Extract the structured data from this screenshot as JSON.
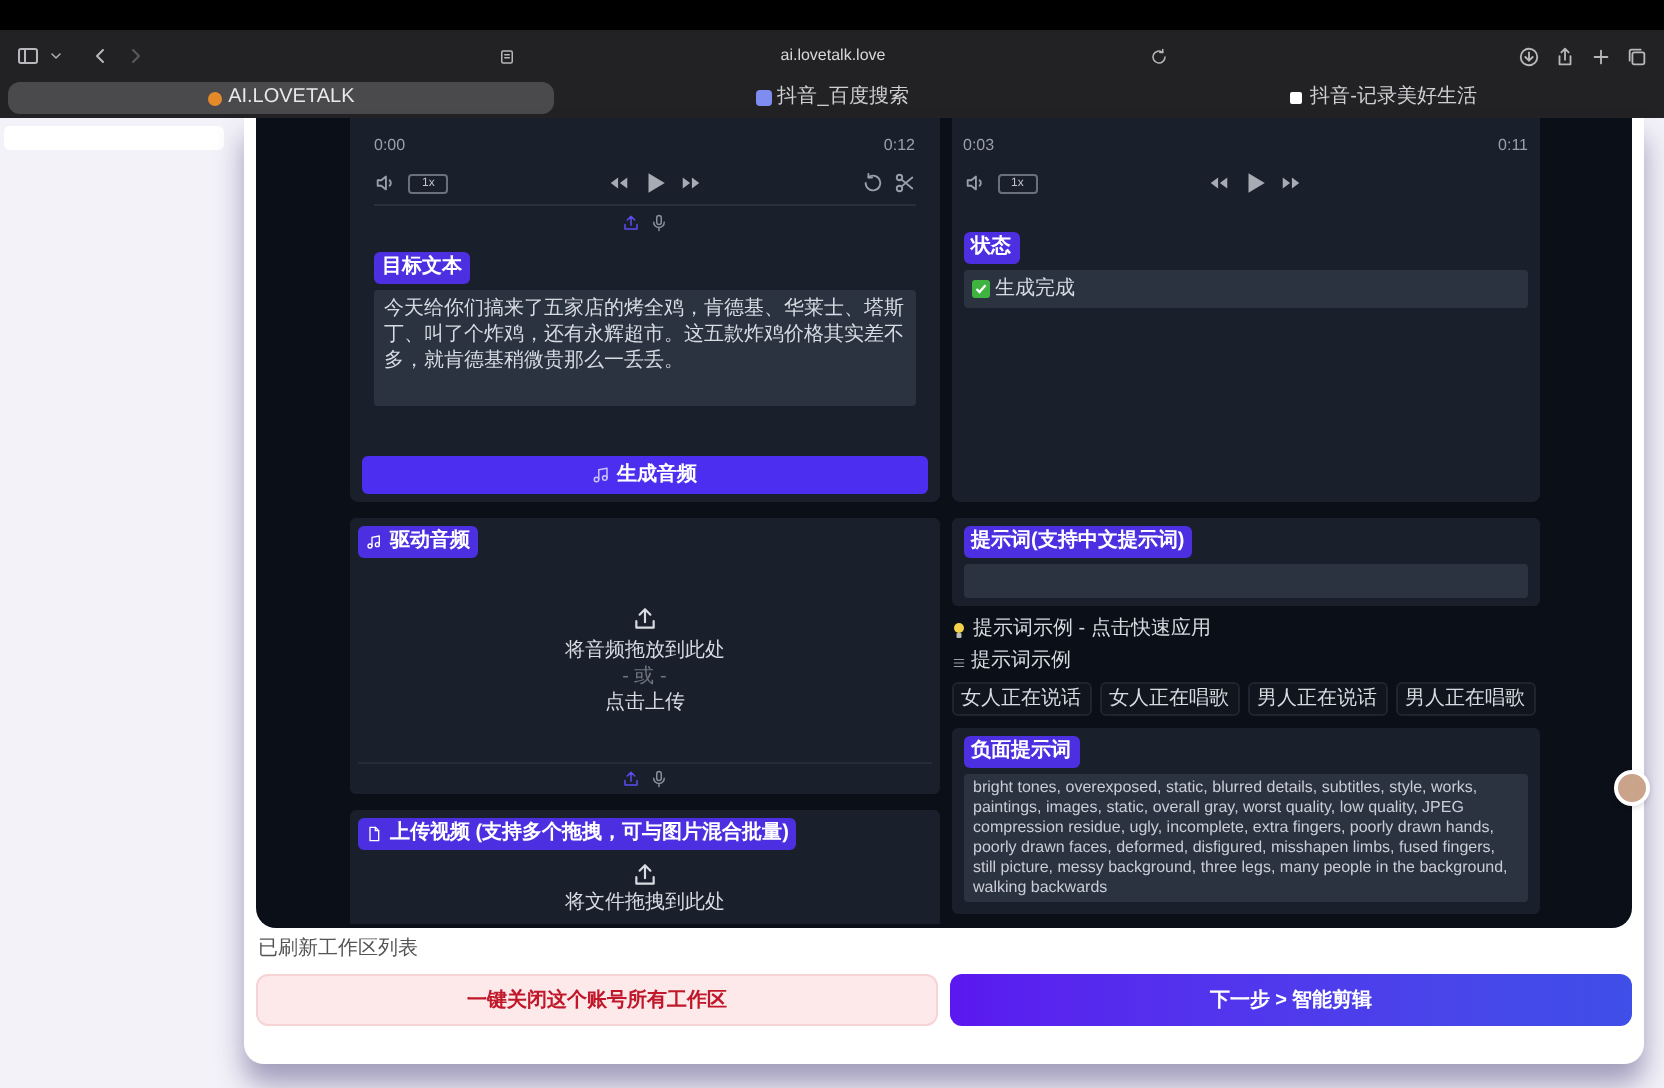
{
  "browser": {
    "url": "ai.lovetalk.love",
    "tabs": [
      {
        "label": "AI.LOVETALK",
        "selected": true
      },
      {
        "label": "抖音_百度搜索",
        "selected": false
      },
      {
        "label": "抖音-记录美好生活",
        "selected": false
      }
    ]
  },
  "players": [
    {
      "time_start": "0:00",
      "time_end": "0:12",
      "speed": "1x",
      "edit_tools": true
    },
    {
      "time_start": "0:03",
      "time_end": "0:11",
      "speed": "1x",
      "edit_tools": false
    }
  ],
  "target_text": {
    "label": "目标文本",
    "value": "今天给你们搞来了五家店的烤全鸡，肯德基、华莱士、塔斯丁、叫了个炸鸡，还有永辉超市。这五款炸鸡价格其实差不多，就肯德基稍微贵那么一丢丢。"
  },
  "generate_button": {
    "label": "生成音频"
  },
  "status": {
    "label": "状态",
    "value": "生成完成",
    "done": true
  },
  "driving_audio": {
    "label": "驱动音频",
    "drop_text": "将音频拖放到此处",
    "or_text": "- 或 -",
    "click_text": "点击上传"
  },
  "prompt": {
    "label": "提示词(支持中文提示词)"
  },
  "examples_tip": "提示词示例 - 点击快速应用",
  "examples_heading": "提示词示例",
  "example_chips": [
    "女人正在说话",
    "女人正在唱歌",
    "男人正在说话",
    "男人正在唱歌"
  ],
  "negative_prompt": {
    "label": "负面提示词",
    "value": "bright tones, overexposed, static, blurred details, subtitles, style, works, paintings, images, static, overall gray, worst quality, low quality, JPEG compression residue, ugly, incomplete, extra fingers, poorly drawn hands, poorly drawn faces, deformed, disfigured, misshapen limbs, fused fingers, still picture, messy background, three legs, many people in the background, walking backwards"
  },
  "upload_video": {
    "label": "上传视频 (支持多个拖拽，可与图片混合批量)",
    "drop_text": "将文件拖拽到此处"
  },
  "notice": "已刷新工作区列表",
  "buttons": [
    {
      "label": "一键关闭这个账号所有工作区",
      "kind": "danger"
    },
    {
      "label": "下一步 > 智能剪辑",
      "kind": "primary"
    }
  ]
}
